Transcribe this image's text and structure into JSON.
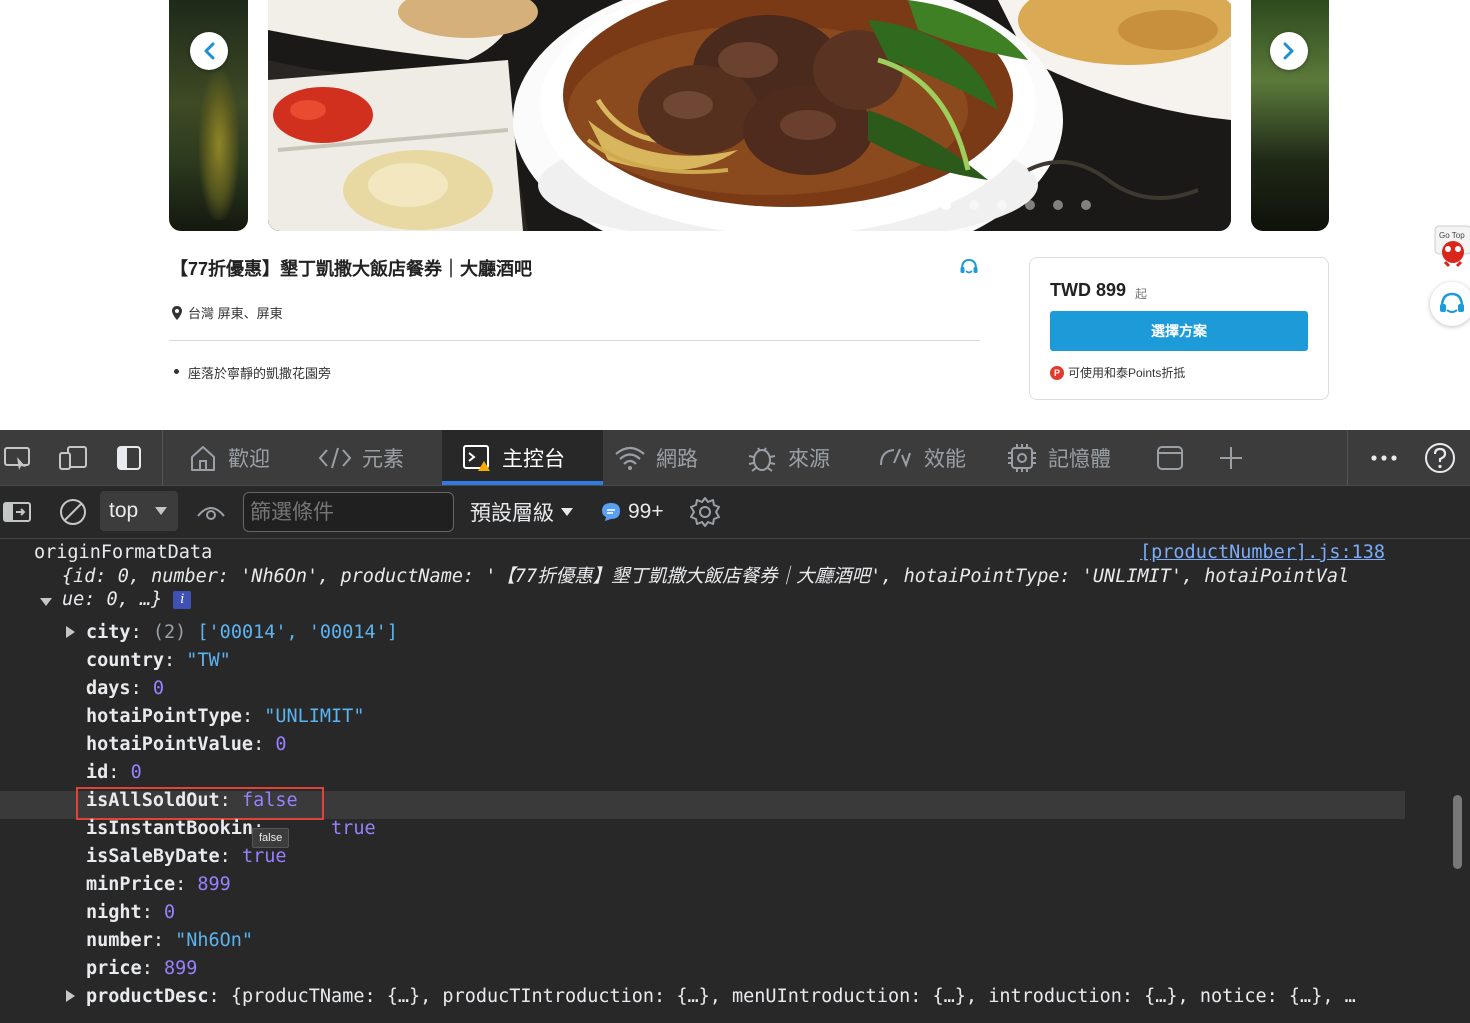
{
  "product": {
    "title": "【77折優惠】墾丁凱撒大飯店餐券｜大廳酒吧",
    "location": "台灣 屏東、屏東",
    "features": [
      "座落於寧靜的凱撒花園旁"
    ],
    "price": "TWD 899",
    "price_suffix": "起",
    "choose_label": "選擇方案",
    "points_note": "可使用和泰Points折抵",
    "points_badge": "P"
  },
  "carousel": {
    "slide_count": 6,
    "active_index": 0
  },
  "gotop_label": "Go Top",
  "devtools": {
    "tabs": [
      {
        "label": "歡迎",
        "icon": "home-icon"
      },
      {
        "label": "元素",
        "icon": "code-icon"
      },
      {
        "label": "主控台",
        "icon": "console-icon"
      },
      {
        "label": "網路",
        "icon": "wifi-icon"
      },
      {
        "label": "來源",
        "icon": "bug-icon"
      },
      {
        "label": "效能",
        "icon": "gauge-icon"
      },
      {
        "label": "記憶體",
        "icon": "chip-icon"
      }
    ],
    "active_tab": "主控台",
    "context": "top",
    "filter_placeholder": "篩選條件",
    "level": "預設層級",
    "message_count": "99+"
  },
  "console": {
    "label": "originFormatData",
    "source": "[productNumber].js:138",
    "summary_line1": "{id: 0, number: 'Nh6On', productName: '【77折優惠】墾丁凱撒大飯店餐券｜大廳酒吧', hotaiPointType: 'UNLIMIT', hotaiPointVal",
    "summary_line2": "ue: 0, …}",
    "info_badge": "i",
    "rows": [
      {
        "key": "city",
        "value": "['00014', '00014']",
        "prefix": "(2) ",
        "type": "array",
        "expandable": true
      },
      {
        "key": "country",
        "value": "\"TW\"",
        "type": "string"
      },
      {
        "key": "days",
        "value": "0",
        "type": "number"
      },
      {
        "key": "hotaiPointType",
        "value": "\"UNLIMIT\"",
        "type": "string"
      },
      {
        "key": "hotaiPointValue",
        "value": "0",
        "type": "number"
      },
      {
        "key": "id",
        "value": "0",
        "type": "number"
      },
      {
        "key": "isAllSoldOut",
        "value": "false",
        "type": "number",
        "highlight": true
      },
      {
        "key": "isInstantBookin",
        "value": "true",
        "type": "number"
      },
      {
        "key": "isSaleByDate",
        "value": "true",
        "type": "number"
      },
      {
        "key": "minPrice",
        "value": "899",
        "type": "number"
      },
      {
        "key": "night",
        "value": "0",
        "type": "number"
      },
      {
        "key": "number",
        "value": "\"Nh6On\"",
        "type": "string"
      },
      {
        "key": "price",
        "value": "899",
        "type": "number"
      },
      {
        "key": "productDesc",
        "value": "{producTName: {…}, producTIntroduction: {…}, menUIntroduction: {…}, introduction: {…}, notice: {…}, …",
        "type": "object",
        "expandable": true
      }
    ],
    "tooltip": "false"
  }
}
